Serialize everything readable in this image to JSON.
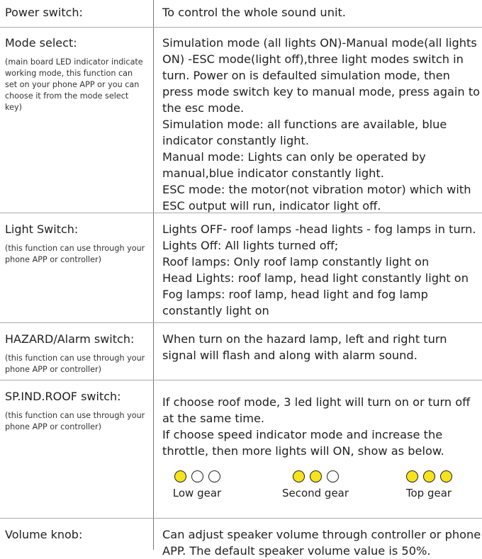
{
  "rows": [
    {
      "label": "Power switch:",
      "lines": [
        "To control the whole sound unit."
      ]
    },
    {
      "label": "Mode select:",
      "note": "(main board LED indicator indicate working mode, this function can set on your phone APP or you can choose it from the mode select key)",
      "lines": [
        "Simulation mode (all lights ON)-Manual mode(all lights ON) -ESC mode(light off),three light modes switch in turn. Power on is defaulted simulation mode, then press mode switch key to manual mode, press again to the esc mode.",
        "Simulation mode: all functions are available, blue indicator constantly light.",
        "Manual mode: Lights can only be operated by manual,blue indicator constantly light.",
        "ESC mode: the motor(not vibration motor) which with ESC output will run, indicator light off."
      ]
    },
    {
      "label": "Light Switch:",
      "note": "(this function can use through your phone APP or controller)",
      "lines": [
        "Lights OFF- roof lamps -head lights - fog lamps in turn.",
        "Lights Off: All lights turned off;",
        "Roof lamps: Only roof lamp constantly light on",
        "Head Lights: roof lamp, head light constantly light on",
        "Fog lamps: roof lamp, head light and fog lamp constantly light on"
      ]
    },
    {
      "label": "HAZARD/Alarm switch:",
      "note": "(this function can use through your phone APP or controller)",
      "lines": [
        "When turn on the hazard lamp, left and right turn signal will flash and along with alarm sound."
      ]
    },
    {
      "label": "SP.IND.ROOF switch:",
      "note": "(this function can use through your phone APP or controller)",
      "lines": [
        "If choose roof mode, 3 led light will turn on or turn off at the same time.",
        "If choose speed indicator mode and increase the throttle, then more lights will ON, show as below."
      ]
    },
    {
      "label": "Volume knob:",
      "lines": [
        "Can adjust speaker volume through controller or phone APP. The default speaker volume value is 50%."
      ]
    }
  ],
  "gears": [
    {
      "label": "Low gear",
      "lit": 1
    },
    {
      "label": "Second gear",
      "lit": 2
    },
    {
      "label": "Top gear",
      "lit": 3
    }
  ],
  "colors": {
    "led_on": "#f6e31c",
    "divider": "#aaaaaa"
  }
}
